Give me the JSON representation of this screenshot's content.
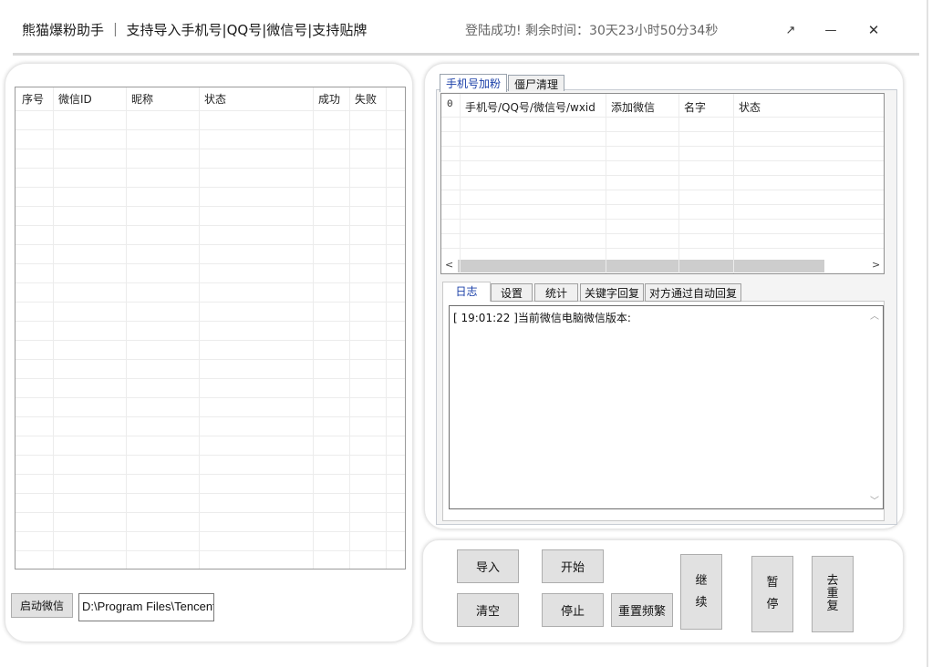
{
  "titlebar": {
    "app_title": "熊猫爆粉助手 ｜ 支持导入手机号|QQ号|微信号|支持贴牌",
    "status": "登陆成功!   剩余时间：30天23小时50分34秒",
    "restore_glyph": "↗",
    "minimize_glyph": "—",
    "close_glyph": "✕"
  },
  "left_panel": {
    "columns": [
      "序号",
      "微信ID",
      "昵称",
      "状态",
      "成功",
      "失败"
    ],
    "start_wechat_label": "启动微信",
    "path_value": "D:\\Program Files\\Tencent"
  },
  "right_panel": {
    "top_tabs": [
      "手机号加粉",
      "僵尸清理"
    ],
    "top_tabs_display": [
      "手机号加粉",
      "僵尸清理"
    ],
    "phone_columns": [
      "0",
      "手机号/QQ号/微信号/wxid",
      "添加微信",
      "名字",
      "状态"
    ],
    "bottom_tabs": [
      "日志",
      "设置",
      "统计",
      "关键字回复",
      "对方通过自动回复"
    ],
    "log_lines": [
      "[ 19:01:22 ]当前微信电脑微信版本:"
    ]
  },
  "controls": {
    "import_label": "导入",
    "start_label": "开始",
    "clear_label": "清空",
    "stop_label": "停止",
    "reset_freq_label": "重置频繁",
    "continue_label": [
      "继",
      "续"
    ],
    "pause_label": [
      "暂",
      "停"
    ],
    "dedupe_label": [
      "去",
      "重",
      "复"
    ]
  },
  "colors": {
    "active_tab_text": "#1a3fa8",
    "button_bg": "#e1e1e1"
  }
}
